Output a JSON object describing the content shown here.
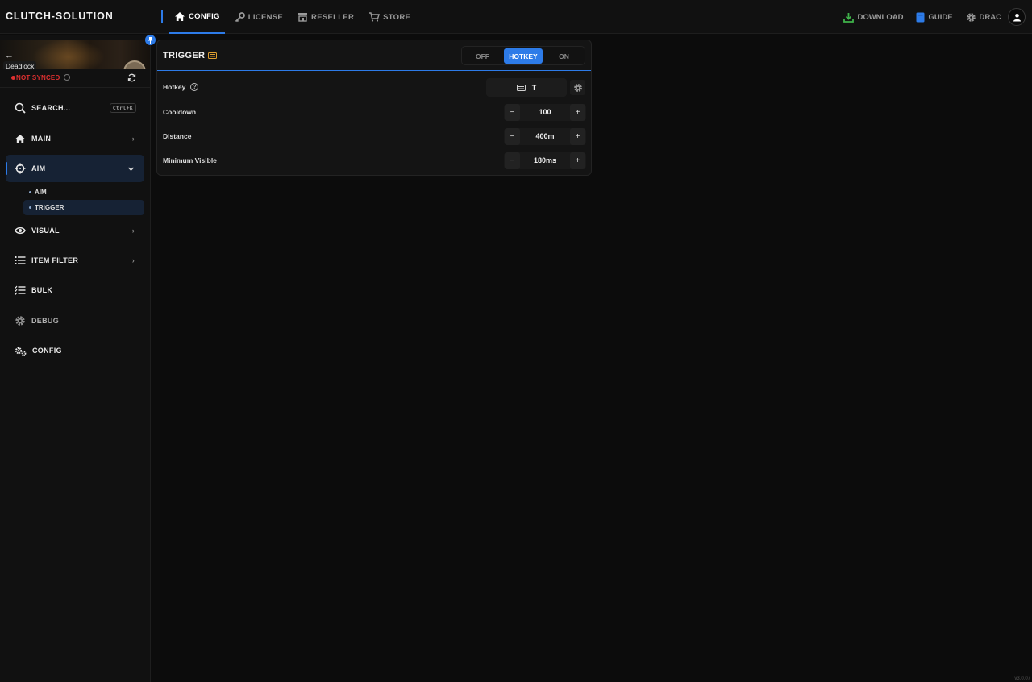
{
  "app": {
    "brand": "CLUTCH-SOLUTION",
    "version": "v3.0.07"
  },
  "topnav": {
    "items": [
      {
        "label": "CONFIG",
        "icon": "home-icon",
        "active": true
      },
      {
        "label": "LICENSE",
        "icon": "key-icon"
      },
      {
        "label": "RESELLER",
        "icon": "store-icon"
      },
      {
        "label": "STORE",
        "icon": "cart-icon"
      }
    ],
    "right": {
      "download": "DOWNLOAD",
      "guide": "GUIDE",
      "user": "DRAC"
    }
  },
  "sidebar": {
    "game": "Deadlock",
    "sync_status": "NOT SYNCED",
    "search": {
      "label": "SEARCH...",
      "shortcut": "Ctrl+K"
    },
    "items": [
      {
        "label": "MAIN",
        "icon": "home-icon"
      },
      {
        "label": "AIM",
        "icon": "crosshair-icon",
        "active": true,
        "expanded": true,
        "children": [
          {
            "label": "AIM"
          },
          {
            "label": "TRIGGER",
            "active": true
          }
        ]
      },
      {
        "label": "VISUAL",
        "icon": "eye-icon"
      },
      {
        "label": "ITEM FILTER",
        "icon": "list-icon"
      },
      {
        "label": "BULK",
        "icon": "checklist-icon"
      },
      {
        "label": "DEBUG",
        "icon": "gear-icon",
        "muted": true
      },
      {
        "label": "CONFIG",
        "icon": "gears-icon"
      }
    ]
  },
  "panel": {
    "title": "TRIGGER",
    "mode": {
      "options": [
        "OFF",
        "HOTKEY",
        "ON"
      ],
      "selected": "HOTKEY"
    },
    "rows": {
      "hotkey": {
        "label": "Hotkey",
        "help": "?",
        "value": "T"
      },
      "cooldown": {
        "label": "Cooldown",
        "value": "100"
      },
      "distance": {
        "label": "Distance",
        "value": "400m"
      },
      "min_visible": {
        "label": "Minimum Visible",
        "value": "180ms"
      }
    },
    "stepper_minus": "−",
    "stepper_plus": "+"
  },
  "colors": {
    "accent": "#2d7be8",
    "danger": "#e03030",
    "download": "#3fb24a",
    "guide": "#2d7be8"
  }
}
